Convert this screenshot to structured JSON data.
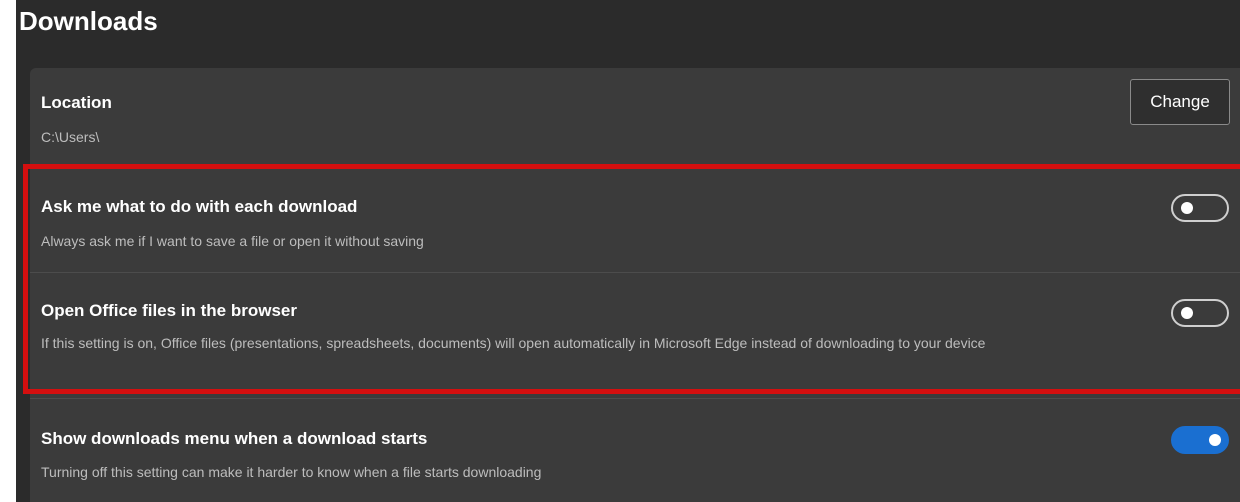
{
  "page": {
    "title": "Downloads"
  },
  "location": {
    "title": "Location",
    "path": "C:\\Users\\",
    "change_label": "Change"
  },
  "settings": [
    {
      "title": "Ask me what to do with each download",
      "description": "Always ask me if I want to save a file or open it without saving",
      "enabled": false
    },
    {
      "title": "Open Office files in the browser",
      "description": "If this setting is on, Office files (presentations, spreadsheets, documents) will open automatically in Microsoft Edge instead of downloading to your device",
      "enabled": false
    },
    {
      "title": "Show downloads menu when a download starts",
      "description": "Turning off this setting can make it harder to know when a file starts downloading",
      "enabled": true
    }
  ],
  "colors": {
    "background": "#2b2b2b",
    "card": "#3b3b3b",
    "toggle_on": "#1a6fd1",
    "highlight": "#d40f0f"
  }
}
